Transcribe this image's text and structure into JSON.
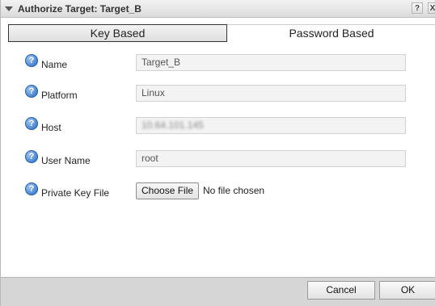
{
  "dialog": {
    "title": "Authorize Target: Target_B",
    "help_button": "?",
    "close_button": "X"
  },
  "tabs": [
    {
      "label": "Key Based",
      "active": true
    },
    {
      "label": "Password Based",
      "active": false
    }
  ],
  "form": {
    "name": {
      "label": "Name",
      "value": "Target_B"
    },
    "platform": {
      "label": "Platform",
      "value": "Linux"
    },
    "host": {
      "label": "Host",
      "value": "10.64.101.145"
    },
    "user_name": {
      "label": "User Name",
      "value": "root"
    },
    "private_key_file": {
      "label": "Private Key File",
      "button_label": "Choose File",
      "status": "No file chosen"
    }
  },
  "help_icon_glyph": "?",
  "footer": {
    "cancel_label": "Cancel",
    "ok_label": "OK"
  },
  "colors": {
    "help_icon": "#3f7fcf",
    "footer_bg": "#d6d6d6",
    "field_bg": "#f3f3f3"
  },
  "icons": [
    "collapse-triangle-icon",
    "help-icon",
    "close-icon"
  ]
}
